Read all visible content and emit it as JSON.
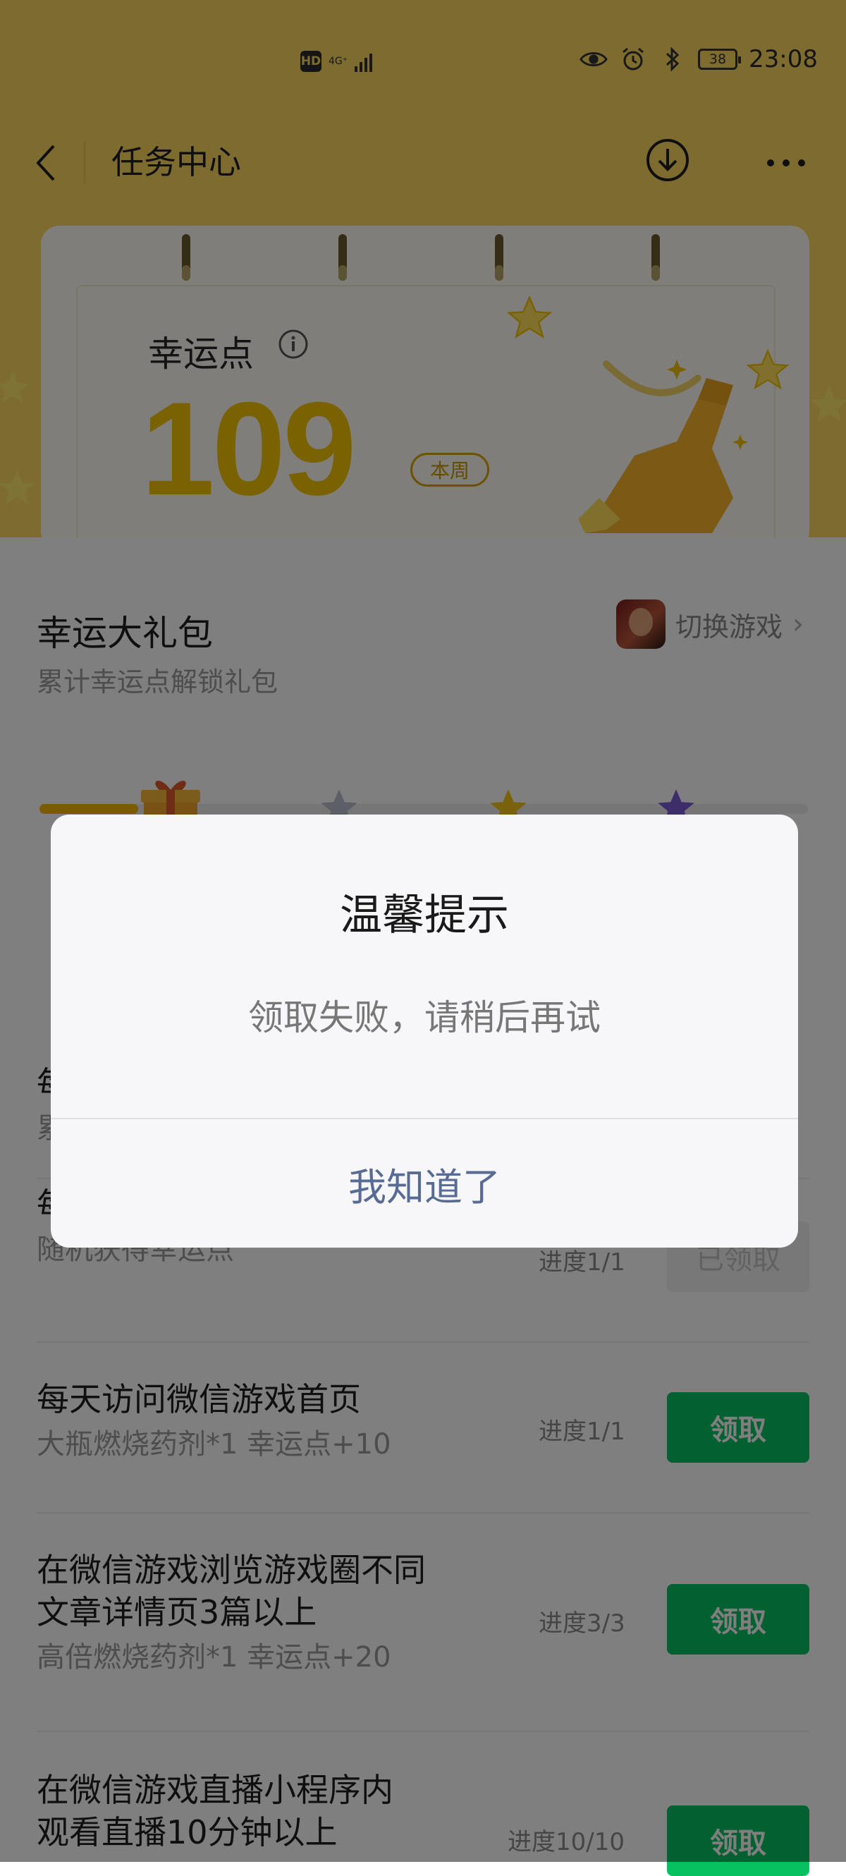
{
  "status_bar": {
    "hd": "HD",
    "network": "4G⁺",
    "battery": "38",
    "time": "23:08"
  },
  "nav": {
    "title": "任务中心"
  },
  "hero": {
    "label": "幸运点",
    "value": "109",
    "period_badge": "本周"
  },
  "gift": {
    "title": "幸运大礼包",
    "subtitle": "累计幸运点解锁礼包",
    "switch_game_label": "切换游戏"
  },
  "tasks": [
    {
      "title": "每",
      "reward": "累",
      "progress": "",
      "button": ""
    },
    {
      "title": "每",
      "reward": "随机获得幸运点",
      "progress": "进度1/1",
      "button": "已领取"
    },
    {
      "title": "每天访问微信游戏首页",
      "reward": "大瓶燃烧药剂*1   幸运点+10",
      "progress": "进度1/1",
      "button": "领取"
    },
    {
      "title": "在微信游戏浏览游戏圈不同",
      "title2": "文章详情页3篇以上",
      "reward": "高倍燃烧药剂*1   幸运点+20",
      "progress": "进度3/3",
      "button": "领取"
    },
    {
      "title": "在微信游戏直播小程序内",
      "title2": "观看直播10分钟以上",
      "reward": "",
      "progress": "进度10/10",
      "button": "领取"
    }
  ],
  "dialog": {
    "title": "温馨提示",
    "message": "领取失败，请稍后再试",
    "confirm": "我知道了"
  },
  "colors": {
    "header_yellow": "#fdd75f",
    "value_yellow": "#f7c500",
    "claim_green": "#07c160",
    "dialog_link": "#576b95"
  }
}
